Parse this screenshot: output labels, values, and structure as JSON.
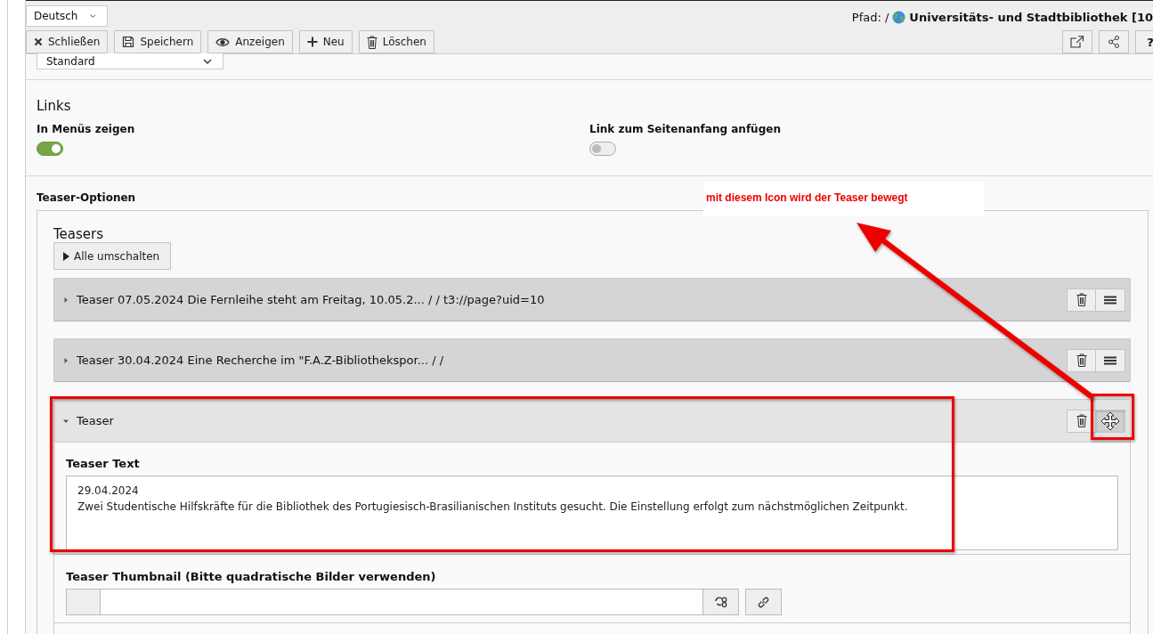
{
  "language_select": {
    "value": "Deutsch"
  },
  "path": {
    "label": "Pfad: /",
    "title": "Universitäts- und Stadtbibliothek [10"
  },
  "toolbar": [
    {
      "kind": "close",
      "label": "Schließen"
    },
    {
      "kind": "save",
      "label": "Speichern"
    },
    {
      "kind": "view",
      "label": "Anzeigen"
    },
    {
      "kind": "new",
      "label": "Neu"
    },
    {
      "kind": "delete",
      "label": "Löschen"
    }
  ],
  "toolbar_right": [
    {
      "kind": "external"
    },
    {
      "kind": "share"
    },
    {
      "kind": "help",
      "label": "?"
    }
  ],
  "layout_select": {
    "value": "Standard"
  },
  "links_section": {
    "title": "Links",
    "toggles": [
      {
        "label": "In Menüs zeigen",
        "on": true
      },
      {
        "label": "Link zum Seitenanfang anfügen",
        "on": false
      }
    ]
  },
  "teaser_options": {
    "title": "Teaser-Optionen",
    "heading": "Teasers",
    "toggle_all": "Alle umschalten",
    "teasers": [
      {
        "title": "Teaser 07.05.2024 Die Fernleihe steht am Freitag, 10.05.2... / / t3://page?uid=10",
        "expanded": false,
        "dragging": false
      },
      {
        "title": "Teaser 30.04.2024 Eine Recherche im \"F.A.Z-Bibliothekspor... / /",
        "expanded": false,
        "dragging": false
      },
      {
        "title": "Teaser",
        "expanded": true,
        "dragging": true,
        "text_label": "Teaser Text",
        "text_value": "29.04.2024\nZwei Studentische Hilfskräfte für die Bibliothek des Portugiesisch-Brasilianischen Instituts gesucht. Die Einstellung erfolgt zum nächstmöglichen Zeitpunkt.",
        "thumbnail_label": "Teaser Thumbnail (Bitte quadratische Bilder verwenden)"
      }
    ]
  },
  "annotation": {
    "text": "mit diesem Icon wird der Teaser bewegt"
  }
}
